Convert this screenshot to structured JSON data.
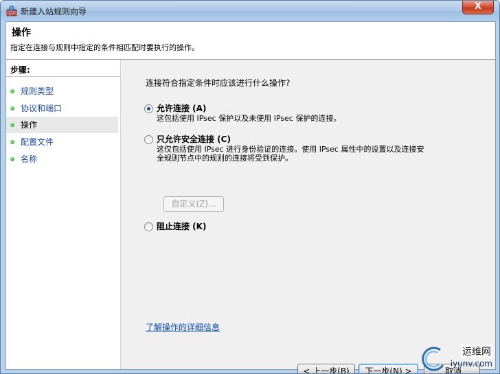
{
  "window": {
    "title": "新建入站规则向导",
    "close_label": "X"
  },
  "header": {
    "title": "操作",
    "description": "指定在连接与规则中指定的条件相匹配时要执行的操作。"
  },
  "steps": {
    "heading": "步骤:",
    "items": [
      {
        "label": "规则类型",
        "current": false
      },
      {
        "label": "协议和端口",
        "current": false
      },
      {
        "label": "操作",
        "current": true
      },
      {
        "label": "配置文件",
        "current": false
      },
      {
        "label": "名称",
        "current": false
      }
    ]
  },
  "main": {
    "question": "连接符合指定条件时应该进行什么操作?",
    "options": [
      {
        "label": "允许连接 (A)",
        "description": [
          "这包括使用 IPsec 保护以及未使用 IPsec 保护的连接。"
        ],
        "checked": true
      },
      {
        "label": "只允许安全连接 (C)",
        "description": [
          "这仅包括使用 IPsec 进行身份验证的连接。使用 IPsec 属性中的设置以及连接安",
          "全规则节点中的规则的连接将受到保护。"
        ],
        "checked": false
      },
      {
        "label": "阻止连接 (K)",
        "description": [],
        "checked": false
      }
    ],
    "customize_label": "自定义(Z)...",
    "learn_more_link": "了解操作的详细信息"
  },
  "footer": {
    "back_label": "< 上一步(B)",
    "next_label": "下一步(N) >",
    "cancel_label": "取消"
  },
  "watermark": {
    "line1": "运维网",
    "line2": "iyunv.com"
  }
}
